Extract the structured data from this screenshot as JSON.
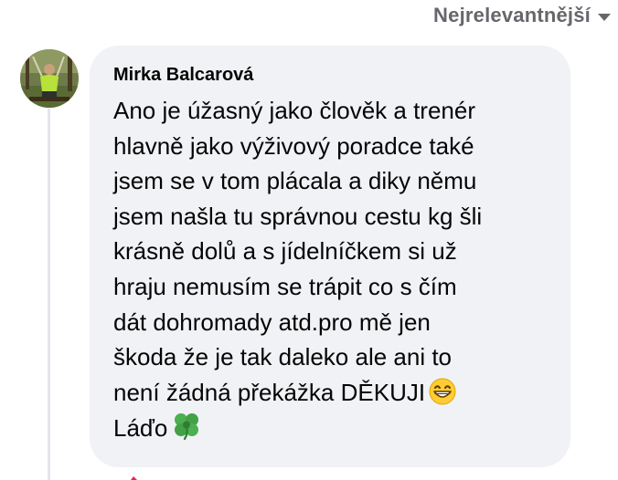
{
  "sort": {
    "label": "Nejrelevantnější",
    "icon": "caret-down-icon"
  },
  "comment": {
    "author": "Mirka Balcarová",
    "lines": [
      "Ano je úžasný jako člověk a trenér",
      "hlavně jako výživový poradce také",
      "jsem se v tom plácala a diky němu",
      "jsem našla tu správnou cestu kg šli",
      "krásně dolů a s jídelníčkem si už",
      "hraju nemusím se trápit co s čím",
      "dát dohromady atd.pro mě jen",
      "škoda že je tak daleko ale ani to",
      "není žádná překážka DĚKUJI",
      "Láďo"
    ],
    "emojis": {
      "grin": "grinning-face-emoji",
      "clover": "four-leaf-clover-emoji"
    }
  },
  "colors": {
    "bubble_bg": "#f0f2f5",
    "text": "#050505",
    "secondary_text": "#65676b",
    "thread_line": "#e4e6eb"
  }
}
